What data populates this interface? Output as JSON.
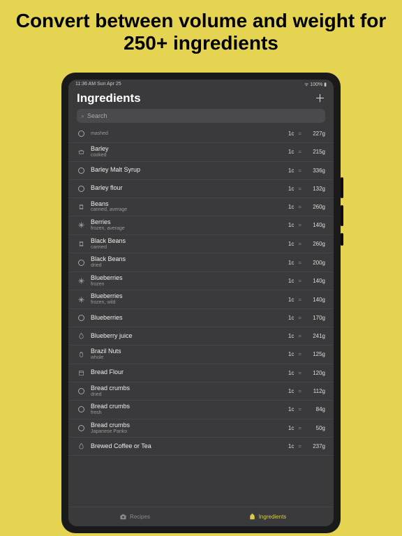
{
  "headline": "Convert between volume and weight for 250+ ingredients",
  "status": {
    "time_day": "11:36 AM  Sun Apr 25",
    "battery": "100%"
  },
  "page_title": "Ingredients",
  "search": {
    "placeholder": "Search"
  },
  "volume_unit": "1c",
  "equals": "=",
  "ingredients": [
    {
      "icon": "circle",
      "name": "",
      "sub": "mashed",
      "weight": "227g"
    },
    {
      "icon": "pot",
      "name": "Barley",
      "sub": "cooked",
      "weight": "215g"
    },
    {
      "icon": "circle",
      "name": "Barley Malt Syrup",
      "sub": "",
      "weight": "336g"
    },
    {
      "icon": "circle",
      "name": "Barley flour",
      "sub": "",
      "weight": "132g"
    },
    {
      "icon": "can",
      "name": "Beans",
      "sub": "canned, average",
      "weight": "260g"
    },
    {
      "icon": "snow",
      "name": "Berries",
      "sub": "frozen, average",
      "weight": "140g"
    },
    {
      "icon": "can",
      "name": "Black Beans",
      "sub": "canned",
      "weight": "260g"
    },
    {
      "icon": "circle",
      "name": "Black Beans",
      "sub": "dried",
      "weight": "200g"
    },
    {
      "icon": "snow",
      "name": "Blueberries",
      "sub": "frozen",
      "weight": "140g"
    },
    {
      "icon": "snow",
      "name": "Blueberries",
      "sub": "frozen, wild",
      "weight": "140g"
    },
    {
      "icon": "circle",
      "name": "Blueberries",
      "sub": "",
      "weight": "170g"
    },
    {
      "icon": "drop",
      "name": "Blueberry juice",
      "sub": "",
      "weight": "241g"
    },
    {
      "icon": "nut",
      "name": "Brazil Nuts",
      "sub": "whole",
      "weight": "125g"
    },
    {
      "icon": "box",
      "name": "Bread Flour",
      "sub": "",
      "weight": "120g"
    },
    {
      "icon": "circle",
      "name": "Bread crumbs",
      "sub": "dried",
      "weight": "112g"
    },
    {
      "icon": "circle",
      "name": "Bread crumbs",
      "sub": "fresh",
      "weight": "84g"
    },
    {
      "icon": "circle",
      "name": "Bread crumbs",
      "sub": "Japanese Panko",
      "weight": "50g"
    },
    {
      "icon": "drop",
      "name": "Brewed Coffee or Tea",
      "sub": "",
      "weight": "237g"
    }
  ],
  "tabs": {
    "recipes": "Recipes",
    "ingredients": "Ingredients"
  }
}
